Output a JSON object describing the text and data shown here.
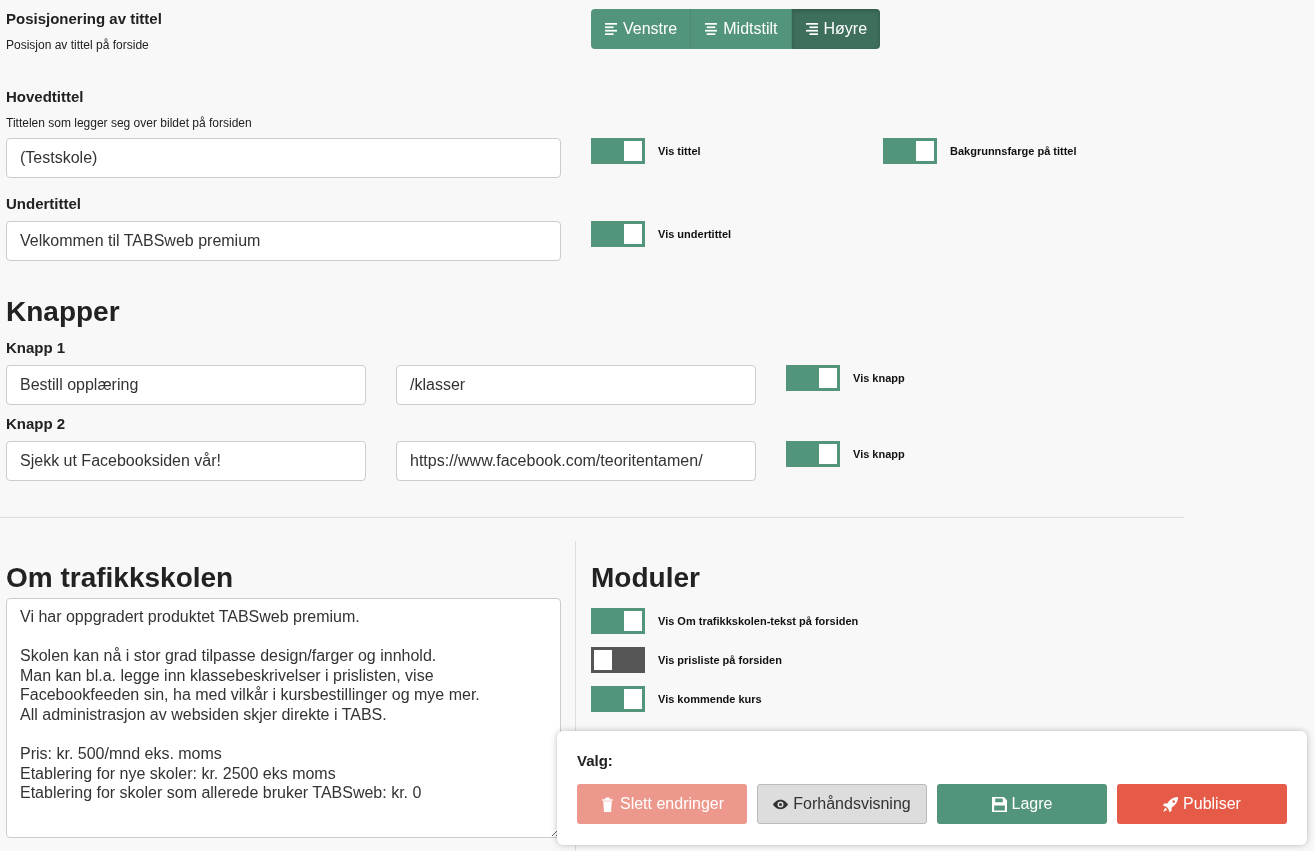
{
  "title_position": {
    "label": "Posisjonering av tittel",
    "description": "Posisjon av tittel på forside",
    "options": [
      {
        "label": "Venstre",
        "kind": "left",
        "selected": false
      },
      {
        "label": "Midtstilt",
        "kind": "center",
        "selected": false
      },
      {
        "label": "Høyre",
        "kind": "right",
        "selected": true
      }
    ]
  },
  "main_title": {
    "label": "Hovedtittel",
    "description": "Tittelen som legger seg over bildet på forsiden",
    "value": "(Testskole)",
    "toggles": [
      {
        "label": "Vis tittel",
        "on": true
      },
      {
        "label": "Bakgrunnsfarge på tittel",
        "on": true
      }
    ]
  },
  "subtitle": {
    "label": "Undertittel",
    "value": "Velkommen til TABSweb premium",
    "toggles": [
      {
        "label": "Vis undertittel",
        "on": true
      }
    ]
  },
  "buttons_section": {
    "heading": "Knapper",
    "items": [
      {
        "label": "Knapp 1",
        "text": "Bestill opplæring",
        "link": "/klasser",
        "toggle": {
          "label": "Vis knapp",
          "on": true
        }
      },
      {
        "label": "Knapp 2",
        "text": "Sjekk ut Facebooksiden vår!",
        "link": "https://www.facebook.com/teoritentamen/",
        "toggle": {
          "label": "Vis knapp",
          "on": true
        }
      }
    ]
  },
  "about": {
    "heading": "Om trafikkskolen",
    "text": "Vi har oppgradert produktet TABSweb premium.\n\nSkolen kan nå i stor grad tilpasse design/farger og innhold.\nMan kan bl.a. legge inn klassebeskrivelser i prislisten, vise\nFacebookfeeden sin, ha med vilkår i kursbestillinger og mye mer.\nAll administrasjon av websiden skjer direkte i TABS.\n\nPris: kr. 500/mnd eks. moms\nEtablering for nye skoler: kr. 2500 eks moms\nEtablering for skoler som allerede bruker TABSweb: kr. 0"
  },
  "modules": {
    "heading": "Moduler",
    "toggles": [
      {
        "label": "Vis Om trafikkskolen-tekst på forsiden",
        "on": true
      },
      {
        "label": "Vis prisliste på forsiden",
        "on": false
      },
      {
        "label": "Vis kommende kurs",
        "on": true
      }
    ]
  },
  "actions": {
    "label": "Valg:",
    "buttons": [
      {
        "label": "Slett endringer",
        "kind": "delete",
        "disabled": true
      },
      {
        "label": "Forhåndsvisning",
        "kind": "preview",
        "disabled": false
      },
      {
        "label": "Lagre",
        "kind": "save",
        "disabled": false
      },
      {
        "label": "Publiser",
        "kind": "publish",
        "disabled": false
      }
    ]
  }
}
